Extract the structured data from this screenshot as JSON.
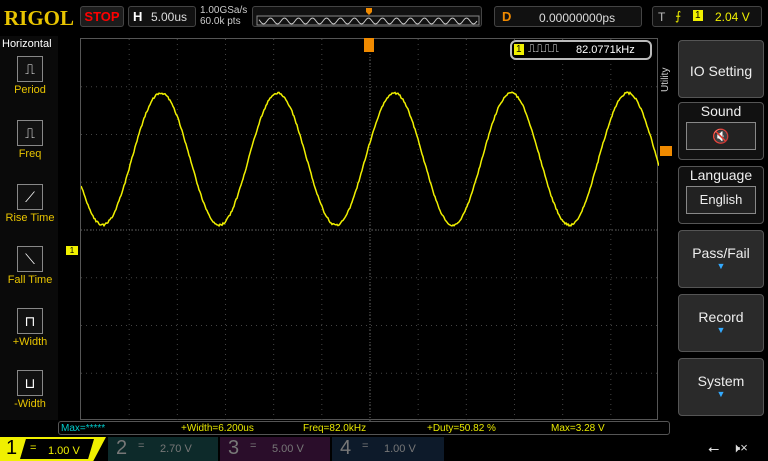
{
  "header": {
    "logo": "RIGOL",
    "run_state": "STOP",
    "h_label": "H",
    "timebase": "5.00us",
    "sample_rate": "1.00GSa/s",
    "memory_depth": "60.0k pts",
    "delay_label": "D",
    "delay": "0.00000000ps",
    "trig_label": "T",
    "trig_channel": "1",
    "trig_level": "2.04 V"
  },
  "freq_counter": {
    "channel": "1",
    "value": "82.0771kHz"
  },
  "left_menu": {
    "title": "Horizontal",
    "items": [
      {
        "label": "Period"
      },
      {
        "label": "Freq"
      },
      {
        "label": "Rise Time"
      },
      {
        "label": "Fall Time"
      },
      {
        "label": "+Width"
      },
      {
        "label": "-Width"
      }
    ]
  },
  "right_menu": {
    "tab": "Utility",
    "items": [
      {
        "label": "IO Setting"
      },
      {
        "label": "Sound",
        "value": "🔇"
      },
      {
        "label": "Language",
        "value": "English"
      },
      {
        "label": "Pass/Fail"
      },
      {
        "label": "Record"
      },
      {
        "label": "System"
      }
    ]
  },
  "measurements": [
    "Max=*****",
    "+Width=6.200us",
    "Freq=82.0kHz",
    "+Duty=50.82 %",
    "Max=3.28 V"
  ],
  "channels": [
    {
      "num": "1",
      "scale": "1.00 V",
      "color": "#f0f000"
    },
    {
      "num": "2",
      "scale": "2.70 V",
      "color": "#00a0a0"
    },
    {
      "num": "3",
      "scale": "5.00 V",
      "color": "#a000a0"
    },
    {
      "num": "4",
      "scale": "1.00 V",
      "color": "#2060c0"
    }
  ],
  "colors": {
    "ch1": "#f0f000",
    "trigger": "#f08a00"
  }
}
